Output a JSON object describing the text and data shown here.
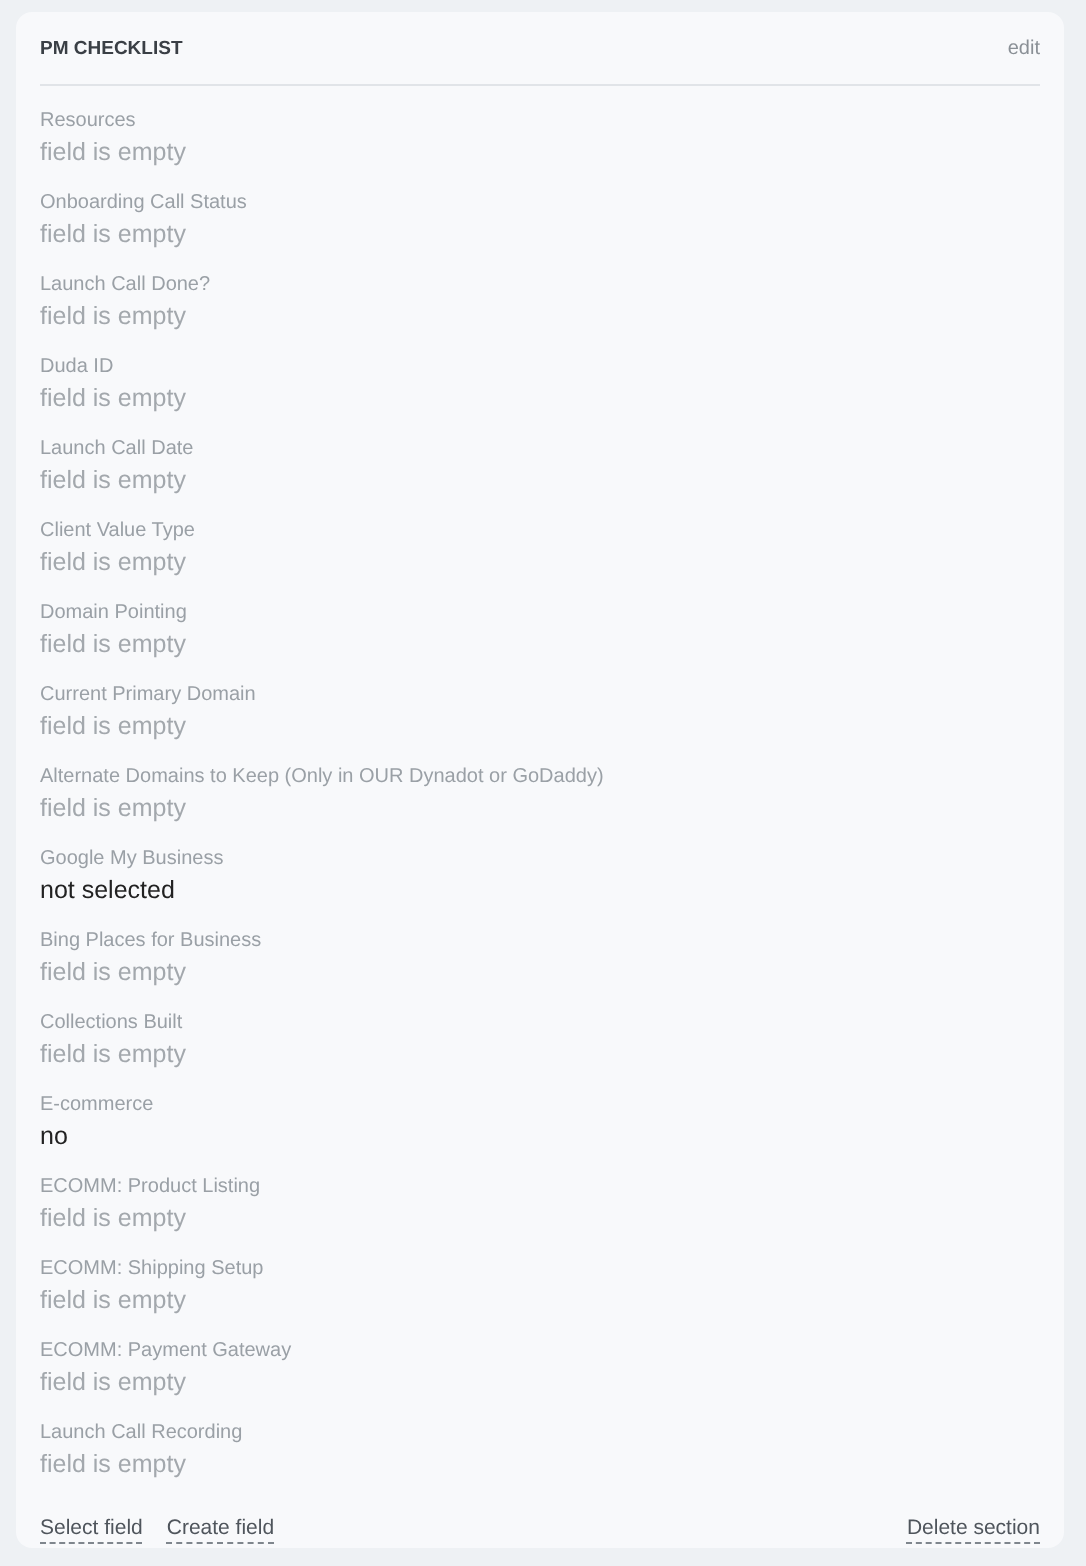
{
  "section": {
    "title": "PM CHECKLIST",
    "edit_link": "edit"
  },
  "fields": [
    {
      "label": "Resources",
      "value": "field is empty",
      "empty": true
    },
    {
      "label": "Onboarding Call Status",
      "value": "field is empty",
      "empty": true
    },
    {
      "label": "Launch Call Done?",
      "value": "field is empty",
      "empty": true
    },
    {
      "label": "Duda ID",
      "value": "field is empty",
      "empty": true
    },
    {
      "label": "Launch Call Date",
      "value": "field is empty",
      "empty": true
    },
    {
      "label": "Client Value Type",
      "value": "field is empty",
      "empty": true
    },
    {
      "label": "Domain Pointing",
      "value": "field is empty",
      "empty": true
    },
    {
      "label": "Current Primary Domain",
      "value": "field is empty",
      "empty": true
    },
    {
      "label": "Alternate Domains to Keep (Only in OUR Dynadot or GoDaddy)",
      "value": "field is empty",
      "empty": true
    },
    {
      "label": "Google My Business",
      "value": "not selected",
      "empty": false
    },
    {
      "label": "Bing Places for Business",
      "value": "field is empty",
      "empty": true
    },
    {
      "label": "Collections Built",
      "value": "field is empty",
      "empty": true
    },
    {
      "label": "E-commerce",
      "value": "no",
      "empty": false
    },
    {
      "label": "ECOMM: Product Listing",
      "value": "field is empty",
      "empty": true
    },
    {
      "label": "ECOMM: Shipping Setup",
      "value": "field is empty",
      "empty": true
    },
    {
      "label": "ECOMM: Payment Gateway",
      "value": "field is empty",
      "empty": true
    },
    {
      "label": "Launch Call Recording",
      "value": "field is empty",
      "empty": true
    }
  ],
  "footer": {
    "left_links": [
      "Select field",
      "Create field"
    ],
    "right_link": "Delete section"
  }
}
